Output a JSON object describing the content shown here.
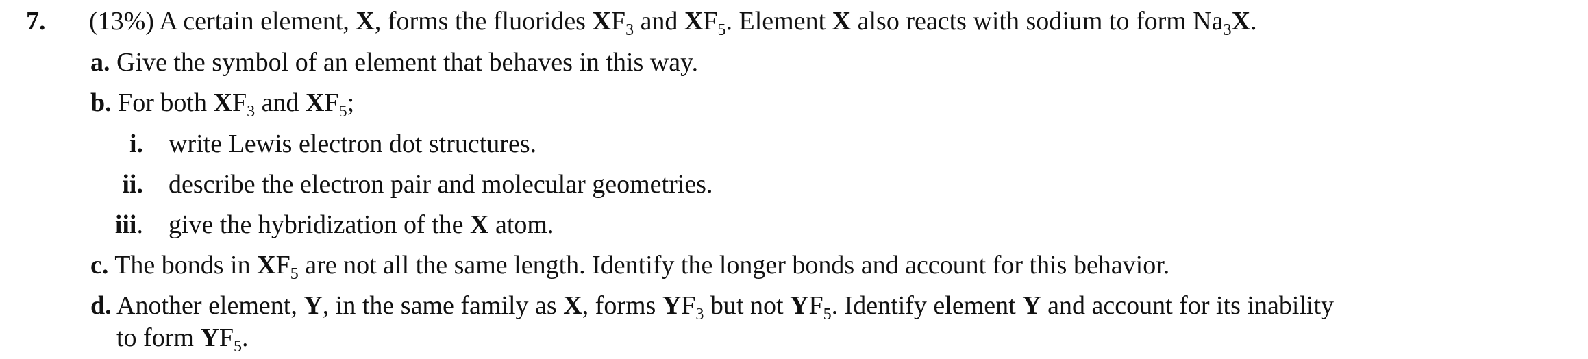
{
  "question": {
    "number": "7.",
    "percent": "(13%)",
    "stem": {
      "t1": " A certain element, ",
      "X": "X",
      "t2": ", forms the fluorides ",
      "F": "F",
      "n3": "3",
      "and": " and ",
      "n5": "5",
      "t3": ". Element ",
      "t4": " also reacts with sodium to form Na",
      "dot": "."
    },
    "part_a": {
      "label": "a.",
      "text": " Give the symbol of an element that behaves in this way."
    },
    "part_b": {
      "label": "b.",
      "t1": " For both ",
      "semi": ";"
    },
    "sub_i": {
      "label": "i.",
      "text": "write Lewis electron dot structures."
    },
    "sub_ii": {
      "label": "ii.",
      "text": "describe the electron pair and molecular geometries."
    },
    "sub_iii": {
      "label": "iii",
      "dot": ".",
      "t1": "give the hybridization of the ",
      "t2": " atom."
    },
    "part_c": {
      "label": "c.",
      "t1": " The bonds in ",
      "t2": " are not all the same length. Identify the longer bonds and account for this behavior."
    },
    "part_d": {
      "label": "d.",
      "t1": " Another element, ",
      "Y": "Y",
      "t2": ", in the same family as ",
      "t3": ", forms ",
      "t4": " but not ",
      "t5": ". Identify element ",
      "t6": " and account for its inability",
      "t7": "to form ",
      "dot": "."
    }
  }
}
